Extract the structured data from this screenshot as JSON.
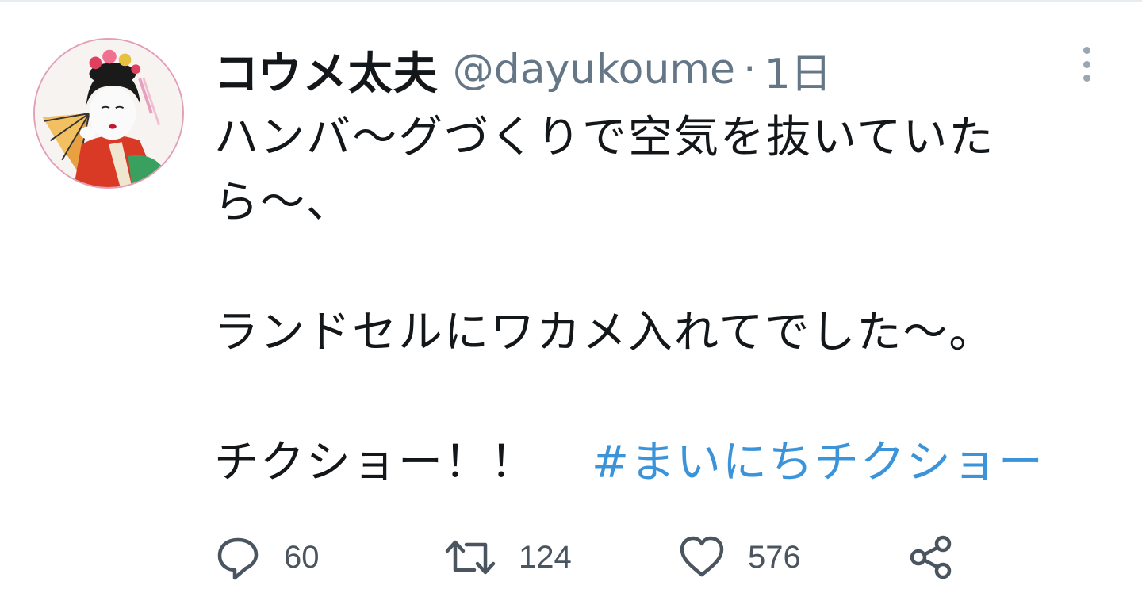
{
  "tweet": {
    "display_name": "コウメ太夫",
    "handle": "@dayukoume",
    "separator": "·",
    "timestamp": "1日",
    "lines": [
      "ハンバ〜グづくりで空気を抜いていた",
      "ら〜、",
      "",
      "ランドセルにワカメ入れてでした〜。",
      "",
      "チクショー！！"
    ],
    "hashtag": "#まいにちチクショー",
    "reply_count": "60",
    "retweet_count": "124",
    "like_count": "576"
  },
  "icons": {
    "avatar": "avatar-photo",
    "more": "more-vertical-icon",
    "reply": "reply-icon",
    "retweet": "retweet-icon",
    "like": "heart-icon",
    "share": "share-icon"
  },
  "colors": {
    "text": "#14171a",
    "secondary": "#657786",
    "link": "#3b94d9",
    "icon": "#4a5560",
    "divider": "#e6ecf0"
  }
}
